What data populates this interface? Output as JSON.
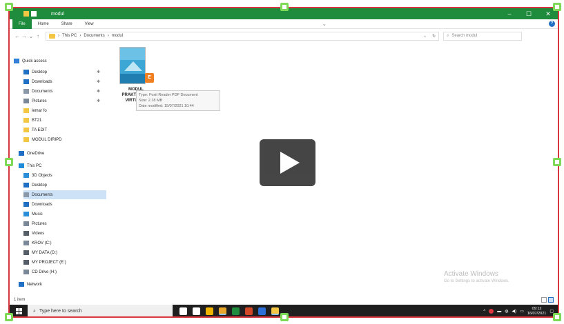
{
  "window": {
    "title": "modul",
    "controls": {
      "minimize": "–",
      "maximize": "☐",
      "close": "✕"
    }
  },
  "ribbon": {
    "tabs": [
      "File",
      "Home",
      "Share",
      "View"
    ]
  },
  "address": {
    "path": [
      "This PC",
      "Documents",
      "modul"
    ],
    "separator": "›",
    "refresh": "↻",
    "dropdown": "⌄",
    "search_placeholder": "Search modul"
  },
  "navpane": {
    "items": [
      {
        "label": "Quick access",
        "icon": "star-icon",
        "color": "#2f7fd8"
      },
      {
        "label": "Desktop",
        "icon": "desktop-icon",
        "color": "#1f6fc5",
        "pinned": true
      },
      {
        "label": "Downloads",
        "icon": "download-icon",
        "color": "#1f6fc5",
        "pinned": true
      },
      {
        "label": "Documents",
        "icon": "document-icon",
        "color": "#8a98a8",
        "pinned": true
      },
      {
        "label": "Pictures",
        "icon": "pictures-icon",
        "color": "#7a8898",
        "pinned": true
      },
      {
        "label": "lemar fo",
        "icon": "folder-icon",
        "color": "#f3c744"
      },
      {
        "label": "BT21",
        "icon": "folder-icon",
        "color": "#f3c744"
      },
      {
        "label": "TA EDIT",
        "icon": "folder-icon",
        "color": "#f3c744"
      },
      {
        "label": "MODUL DIRIPD",
        "icon": "folder-icon",
        "color": "#f3c744"
      },
      {
        "label": "OneDrive",
        "icon": "cloud-icon",
        "color": "#1f6fc5"
      },
      {
        "label": "This PC",
        "icon": "computer-icon",
        "color": "#1f8ad8"
      },
      {
        "label": "3D Objects",
        "icon": "cube-icon",
        "color": "#2a8fd8"
      },
      {
        "label": "Desktop",
        "icon": "desktop-icon",
        "color": "#1f6fc5"
      },
      {
        "label": "Documents",
        "icon": "document-icon",
        "color": "#8a98a8",
        "selected": true
      },
      {
        "label": "Downloads",
        "icon": "download-icon",
        "color": "#1f6fc5"
      },
      {
        "label": "Music",
        "icon": "music-icon",
        "color": "#2a8fd8"
      },
      {
        "label": "Pictures",
        "icon": "pictures-icon",
        "color": "#7a8898"
      },
      {
        "label": "Videos",
        "icon": "video-icon",
        "color": "#555e68"
      },
      {
        "label": "KROV (C:)",
        "icon": "drive-icon",
        "color": "#7a8898"
      },
      {
        "label": "MY DATA (D:)",
        "icon": "drive-icon",
        "color": "#555e68"
      },
      {
        "label": "MY PROJECT (E:)",
        "icon": "drive-icon",
        "color": "#555e68"
      },
      {
        "label": "CD Drive (H:)",
        "icon": "cd-drive-icon",
        "color": "#7a8898"
      },
      {
        "label": "Network",
        "icon": "network-icon",
        "color": "#1f6fc5"
      }
    ]
  },
  "file": {
    "name_lines": [
      "MODUL",
      "PRAKTIKUM...",
      "VIRTUAL..."
    ],
    "badge": "E",
    "tooltip_lines": [
      "Type: Foxit Reader PDF Document",
      "Size: 2.18 MB",
      "Date modified: 15/07/2021 10:44"
    ]
  },
  "status": {
    "items_count": "1 item"
  },
  "watermark": {
    "line1": "Activate Windows",
    "line2": "Go to Settings to activate Windows."
  },
  "taskbar": {
    "search_placeholder": "Type here to search",
    "apps": [
      {
        "icon": "task-view-icon",
        "color": "#ffffff"
      },
      {
        "icon": "store-icon",
        "color": "#ffffff"
      },
      {
        "icon": "app-yellow-icon",
        "color": "#f0b400"
      },
      {
        "icon": "chrome-icon",
        "color": "#e8a62a",
        "active": true
      },
      {
        "icon": "excel-icon",
        "color": "#1e8b3d"
      },
      {
        "icon": "powerpoint-icon",
        "color": "#d24726"
      },
      {
        "icon": "word-icon",
        "color": "#2b6fd8"
      },
      {
        "icon": "file-explorer-icon",
        "color": "#f3c744",
        "active": true
      }
    ],
    "clock_time": "09:12",
    "clock_date": "16/07/2021"
  }
}
